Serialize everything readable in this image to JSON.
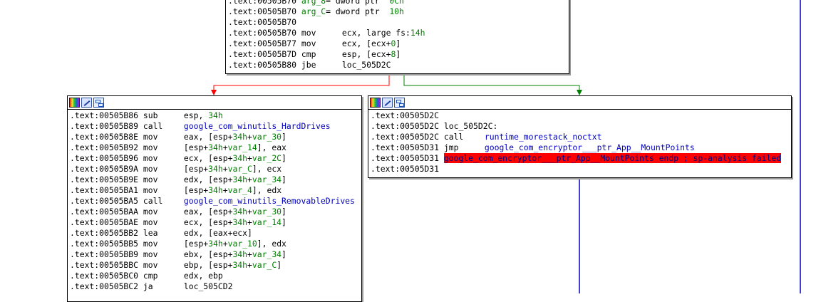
{
  "colors": {
    "edge_false": "#ff0000",
    "edge_true": "#008000",
    "edge_uncond": "#0000c0",
    "highlight_bg": "#ff0000"
  },
  "header_icons": [
    "color-palette-icon",
    "edit-pencil-icon",
    "graph-overview-icon"
  ],
  "top_block": {
    "lines": [
      [
        {
          "t": ".text:00505B70 ",
          "c": "addr"
        },
        {
          "t": "arg_8",
          "c": "num"
        },
        {
          "t": "= dword ptr  ",
          "c": "op"
        },
        {
          "t": "0Ch",
          "c": "num"
        }
      ],
      [
        {
          "t": ".text:00505B70 ",
          "c": "addr"
        },
        {
          "t": "arg_C",
          "c": "num"
        },
        {
          "t": "= dword ptr  ",
          "c": "op"
        },
        {
          "t": "10h",
          "c": "num"
        }
      ],
      [
        {
          "t": ".text:00505B70",
          "c": "addr"
        }
      ],
      [
        {
          "t": ".text:00505B70 ",
          "c": "addr"
        },
        {
          "t": "mov",
          "c": "mn"
        },
        {
          "t": "ecx, large fs:",
          "c": "op"
        },
        {
          "t": "14h",
          "c": "num"
        }
      ],
      [
        {
          "t": ".text:00505B77 ",
          "c": "addr"
        },
        {
          "t": "mov",
          "c": "mn"
        },
        {
          "t": "ecx, [ecx+",
          "c": "op"
        },
        {
          "t": "0",
          "c": "num"
        },
        {
          "t": "]",
          "c": "op"
        }
      ],
      [
        {
          "t": ".text:00505B7D ",
          "c": "addr"
        },
        {
          "t": "cmp",
          "c": "mn"
        },
        {
          "t": "esp, [ecx+",
          "c": "op"
        },
        {
          "t": "8",
          "c": "num"
        },
        {
          "t": "]",
          "c": "op"
        }
      ],
      [
        {
          "t": ".text:00505B80 ",
          "c": "addr"
        },
        {
          "t": "jbe",
          "c": "mn"
        },
        {
          "t": "loc_505D2C",
          "c": "op"
        }
      ]
    ]
  },
  "left_block": {
    "lines": [
      [
        {
          "t": ".text:00505B86 ",
          "c": "addr"
        },
        {
          "t": "sub",
          "c": "mn"
        },
        {
          "t": "esp, ",
          "c": "op"
        },
        {
          "t": "34h",
          "c": "num"
        }
      ],
      [
        {
          "t": ".text:00505B89 ",
          "c": "addr"
        },
        {
          "t": "call",
          "c": "mn"
        },
        {
          "t": "google_com_winutils_HardDrives",
          "c": "sym"
        }
      ],
      [
        {
          "t": ".text:00505B8E ",
          "c": "addr"
        },
        {
          "t": "mov",
          "c": "mn"
        },
        {
          "t": "eax, [esp+",
          "c": "op"
        },
        {
          "t": "34h",
          "c": "num"
        },
        {
          "t": "+",
          "c": "op"
        },
        {
          "t": "var_30",
          "c": "num"
        },
        {
          "t": "]",
          "c": "op"
        }
      ],
      [
        {
          "t": ".text:00505B92 ",
          "c": "addr"
        },
        {
          "t": "mov",
          "c": "mn"
        },
        {
          "t": "[esp+",
          "c": "op"
        },
        {
          "t": "34h",
          "c": "num"
        },
        {
          "t": "+",
          "c": "op"
        },
        {
          "t": "var_14",
          "c": "num"
        },
        {
          "t": "], eax",
          "c": "op"
        }
      ],
      [
        {
          "t": ".text:00505B96 ",
          "c": "addr"
        },
        {
          "t": "mov",
          "c": "mn"
        },
        {
          "t": "ecx, [esp+",
          "c": "op"
        },
        {
          "t": "34h",
          "c": "num"
        },
        {
          "t": "+",
          "c": "op"
        },
        {
          "t": "var_2C",
          "c": "num"
        },
        {
          "t": "]",
          "c": "op"
        }
      ],
      [
        {
          "t": ".text:00505B9A ",
          "c": "addr"
        },
        {
          "t": "mov",
          "c": "mn"
        },
        {
          "t": "[esp+",
          "c": "op"
        },
        {
          "t": "34h",
          "c": "num"
        },
        {
          "t": "+",
          "c": "op"
        },
        {
          "t": "var_C",
          "c": "num"
        },
        {
          "t": "], ecx",
          "c": "op"
        }
      ],
      [
        {
          "t": ".text:00505B9E ",
          "c": "addr"
        },
        {
          "t": "mov",
          "c": "mn"
        },
        {
          "t": "edx, [esp+",
          "c": "op"
        },
        {
          "t": "34h",
          "c": "num"
        },
        {
          "t": "+",
          "c": "op"
        },
        {
          "t": "var_34",
          "c": "num"
        },
        {
          "t": "]",
          "c": "op"
        }
      ],
      [
        {
          "t": ".text:00505BA1 ",
          "c": "addr"
        },
        {
          "t": "mov",
          "c": "mn"
        },
        {
          "t": "[esp+",
          "c": "op"
        },
        {
          "t": "34h",
          "c": "num"
        },
        {
          "t": "+",
          "c": "op"
        },
        {
          "t": "var_4",
          "c": "num"
        },
        {
          "t": "], edx",
          "c": "op"
        }
      ],
      [
        {
          "t": ".text:00505BA5 ",
          "c": "addr"
        },
        {
          "t": "call",
          "c": "mn"
        },
        {
          "t": "google_com_winutils_RemovableDrives",
          "c": "sym"
        }
      ],
      [
        {
          "t": ".text:00505BAA ",
          "c": "addr"
        },
        {
          "t": "mov",
          "c": "mn"
        },
        {
          "t": "eax, [esp+",
          "c": "op"
        },
        {
          "t": "34h",
          "c": "num"
        },
        {
          "t": "+",
          "c": "op"
        },
        {
          "t": "var_30",
          "c": "num"
        },
        {
          "t": "]",
          "c": "op"
        }
      ],
      [
        {
          "t": ".text:00505BAE ",
          "c": "addr"
        },
        {
          "t": "mov",
          "c": "mn"
        },
        {
          "t": "ecx, [esp+",
          "c": "op"
        },
        {
          "t": "34h",
          "c": "num"
        },
        {
          "t": "+",
          "c": "op"
        },
        {
          "t": "var_14",
          "c": "num"
        },
        {
          "t": "]",
          "c": "op"
        }
      ],
      [
        {
          "t": ".text:00505BB2 ",
          "c": "addr"
        },
        {
          "t": "lea",
          "c": "mn"
        },
        {
          "t": "edx, [eax+ecx]",
          "c": "op"
        }
      ],
      [
        {
          "t": ".text:00505BB5 ",
          "c": "addr"
        },
        {
          "t": "mov",
          "c": "mn"
        },
        {
          "t": "[esp+",
          "c": "op"
        },
        {
          "t": "34h",
          "c": "num"
        },
        {
          "t": "+",
          "c": "op"
        },
        {
          "t": "var_10",
          "c": "num"
        },
        {
          "t": "], edx",
          "c": "op"
        }
      ],
      [
        {
          "t": ".text:00505BB9 ",
          "c": "addr"
        },
        {
          "t": "mov",
          "c": "mn"
        },
        {
          "t": "ebx, [esp+",
          "c": "op"
        },
        {
          "t": "34h",
          "c": "num"
        },
        {
          "t": "+",
          "c": "op"
        },
        {
          "t": "var_34",
          "c": "num"
        },
        {
          "t": "]",
          "c": "op"
        }
      ],
      [
        {
          "t": ".text:00505BBC ",
          "c": "addr"
        },
        {
          "t": "mov",
          "c": "mn"
        },
        {
          "t": "ebp, [esp+",
          "c": "op"
        },
        {
          "t": "34h",
          "c": "num"
        },
        {
          "t": "+",
          "c": "op"
        },
        {
          "t": "var_C",
          "c": "num"
        },
        {
          "t": "]",
          "c": "op"
        }
      ],
      [
        {
          "t": ".text:00505BC0 ",
          "c": "addr"
        },
        {
          "t": "cmp",
          "c": "mn"
        },
        {
          "t": "edx, ebp",
          "c": "op"
        }
      ],
      [
        {
          "t": ".text:00505BC2 ",
          "c": "addr"
        },
        {
          "t": "ja",
          "c": "mn"
        },
        {
          "t": "loc_505CD2",
          "c": "op"
        }
      ]
    ]
  },
  "right_block": {
    "lines": [
      [
        {
          "t": ".text:00505D2C",
          "c": "addr"
        }
      ],
      [
        {
          "t": ".text:00505D2C ",
          "c": "addr"
        },
        {
          "t": "loc_505D2C:",
          "c": "lbl"
        }
      ],
      [
        {
          "t": ".text:00505D2C ",
          "c": "addr"
        },
        {
          "t": "call",
          "c": "mn"
        },
        {
          "t": "runtime_morestack_noctxt",
          "c": "sym"
        }
      ],
      [
        {
          "t": ".text:00505D31 ",
          "c": "addr"
        },
        {
          "t": "jmp",
          "c": "mn"
        },
        {
          "t": "google_com_encryptor___ptr_App__MountPoints",
          "c": "sym"
        }
      ],
      [
        {
          "t": ".text:00505D31 ",
          "c": "addr"
        },
        {
          "t": "google_com_encryptor___ptr_App__MountPoints endp ; sp-analysis failed",
          "c": "hl"
        }
      ],
      [
        {
          "t": ".text:00505D31",
          "c": "addr"
        }
      ]
    ]
  }
}
